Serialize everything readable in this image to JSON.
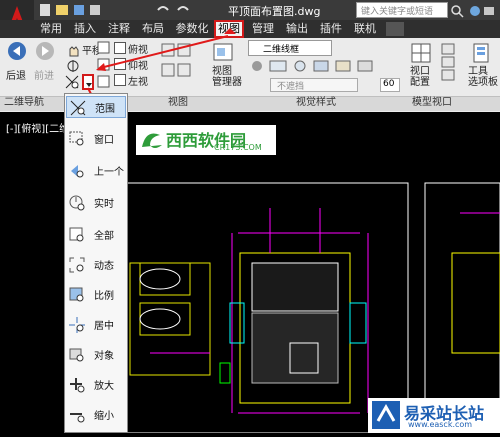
{
  "title": {
    "file": "平顶面布置图.dwg",
    "search_placeholder": "键入关键字或短语"
  },
  "tabs": [
    "常用",
    "插入",
    "注释",
    "布局",
    "参数化",
    "视图",
    "管理",
    "输出",
    "插件",
    "联机"
  ],
  "ribbon": {
    "nav": {
      "back": "后退",
      "forward": "前进",
      "pan": "平移"
    },
    "views": {
      "top": "俯视",
      "bottom": "仰视",
      "left": "左视"
    },
    "view_manager": "视图\n管理器",
    "visual_style": "二维线框",
    "no_occlusion": "不遮挡",
    "opacity": "60",
    "viewport_config": "视口\n配置",
    "tool_palette": "工具\n选项板",
    "panels": {
      "nav2d": "二维导航",
      "view": "视图",
      "visual_styles": "视觉样式",
      "model_viewports": "模型视口"
    }
  },
  "viewport_label": "[-][俯视][二维线框]",
  "zoom_menu": [
    "范围",
    "窗口",
    "上一个",
    "实时",
    "全部",
    "动态",
    "比例",
    "居中",
    "对象",
    "放大",
    "缩小"
  ],
  "logo": {
    "text": "西西软件园",
    "sub": "CR173.COM"
  },
  "watermark": {
    "text": "易采站长站",
    "sub": "www.easck.com"
  },
  "colors": {
    "accent": "#d21a1a",
    "canvas": "#000000",
    "selected": "#cfe3f7"
  }
}
